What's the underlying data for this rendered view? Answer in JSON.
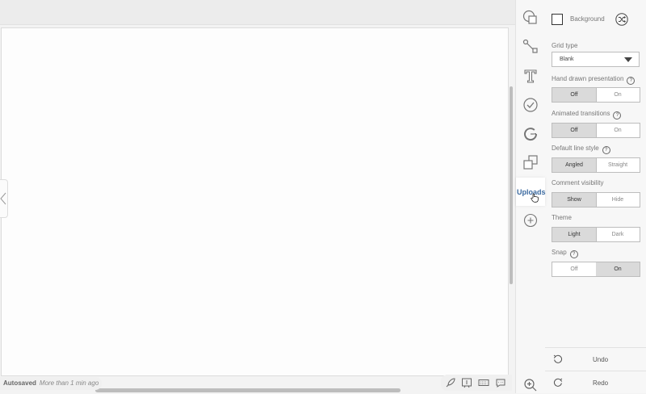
{
  "status": {
    "autosave_label": "Autosaved",
    "autosave_time": "More than 1 min ago"
  },
  "rail": {
    "uploads_label": "Uploads"
  },
  "panel": {
    "background_label": "Background",
    "grid_type": {
      "label": "Grid type",
      "value": "Blank"
    },
    "hand_drawn": {
      "label": "Hand drawn presentation",
      "help": "?",
      "options": [
        "Off",
        "On"
      ],
      "selected": "Off"
    },
    "animated": {
      "label": "Animated transitions",
      "help": "?",
      "options": [
        "Off",
        "On"
      ],
      "selected": "Off"
    },
    "line_style": {
      "label": "Default line style",
      "help": "?",
      "options": [
        "Angled",
        "Straight"
      ],
      "selected": "Angled"
    },
    "comments": {
      "label": "Comment visibility",
      "options": [
        "Show",
        "Hide"
      ],
      "selected": "Show"
    },
    "theme": {
      "label": "Theme",
      "options": [
        "Light",
        "Dark"
      ],
      "selected": "Light"
    },
    "snap": {
      "label": "Snap",
      "help": "?",
      "options": [
        "Off",
        "On"
      ],
      "selected": "On"
    },
    "undo_label": "Undo",
    "redo_label": "Redo"
  },
  "colors": {
    "accent": "#3b6aa0",
    "selected_toggle": "#dadada"
  }
}
